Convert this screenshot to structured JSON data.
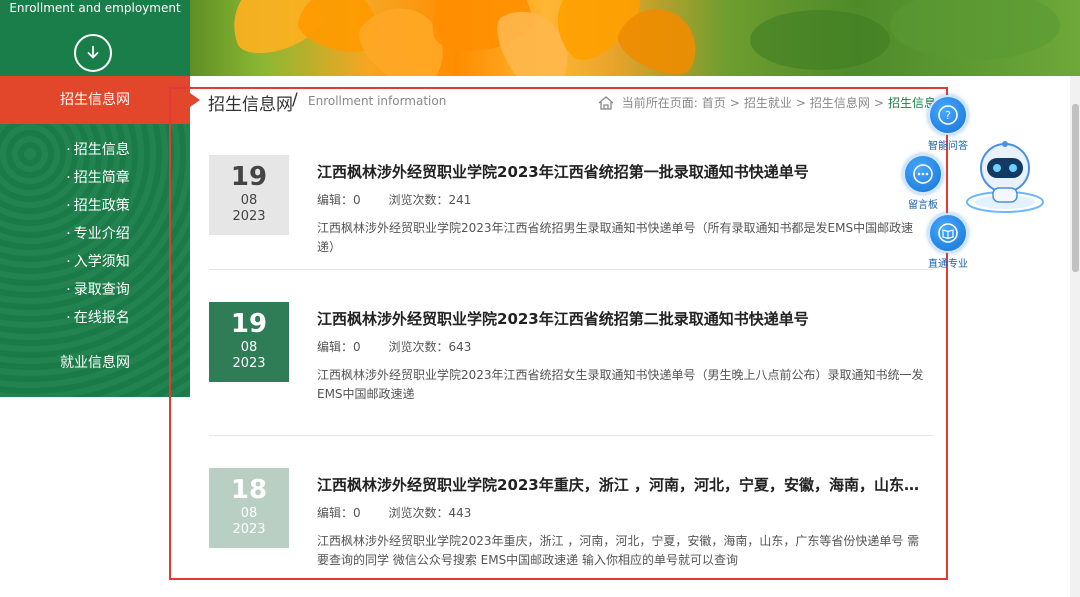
{
  "sidebar": {
    "top_title": "Enrollment and employment",
    "active": "招生信息网",
    "items": [
      {
        "label": "招生信息"
      },
      {
        "label": "招生简章"
      },
      {
        "label": "招生政策"
      },
      {
        "label": "专业介绍"
      },
      {
        "label": "入学须知"
      },
      {
        "label": "录取查询"
      },
      {
        "label": "在线报名"
      }
    ],
    "bullet": "·",
    "job": "就业信息网"
  },
  "header": {
    "title": "招生信息网",
    "slash": "/",
    "subtitle": "Enrollment information",
    "breadcrumb": {
      "prefix": "当前所在页面:",
      "items": [
        "首页",
        "招生就业",
        "招生信息网",
        "招生信息"
      ],
      "separator": ">"
    }
  },
  "articles": [
    {
      "day": "19",
      "month": "08",
      "year": "2023",
      "title": "江西枫林涉外经贸职业学院2023年江西省统招第一批录取通知书快递单号",
      "editor": "编辑：0",
      "views": "浏览次数：241",
      "summary": "江西枫林涉外经贸职业学院2023年江西省统招男生录取通知书快递单号（所有录取通知书都是发EMS中国邮政速递）",
      "date_bg": "#e6e6e6",
      "date_color": "#444444"
    },
    {
      "day": "19",
      "month": "08",
      "year": "2023",
      "title": "江西枫林涉外经贸职业学院2023年江西省统招第二批录取通知书快递单号",
      "editor": "编辑：0",
      "views": "浏览次数：643",
      "summary": "江西枫林涉外经贸职业学院2023年江西省统招女生录取通知书快递单号（男生晚上八点前公布）录取通知书统一发EMS中国邮政速递",
      "date_bg": "#2f7d56",
      "date_color": "#ffffff"
    },
    {
      "day": "18",
      "month": "08",
      "year": "2023",
      "title": "江西枫林涉外经贸职业学院2023年重庆，浙江 ，河南，河北，宁夏，安徽，海南，山东，广东...",
      "editor": "编辑：0",
      "views": "浏览次数：443",
      "summary": "江西枫林涉外经贸职业学院2023年重庆，浙江 ，河南，河北，宁夏，安徽，海南，山东，广东等省份快递单号 需要查询的同学 微信公众号搜索 EMS中国邮政速递 输入你相应的单号就可以查询",
      "date_bg": "#b9cfc3",
      "date_color": "#ffffff"
    }
  ],
  "floating": {
    "qa": "智能问答",
    "board": "留言板",
    "major": "直通专业"
  },
  "colors": {
    "sidebar_green": "#1b7f4a",
    "active_red": "#e2472b",
    "frame_red": "#e53935"
  }
}
